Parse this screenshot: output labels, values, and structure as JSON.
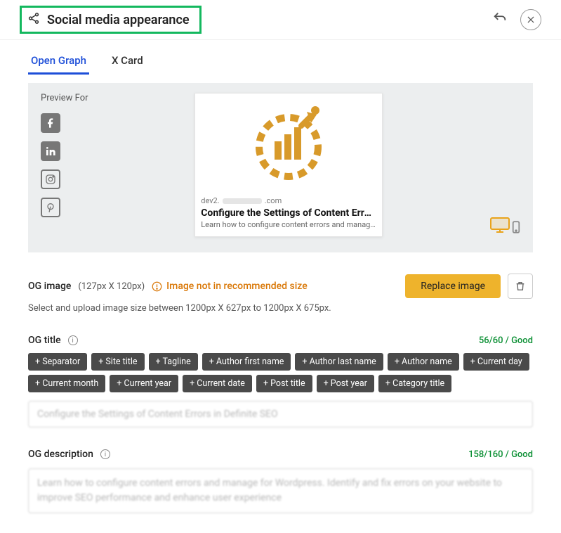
{
  "header": {
    "title": "Social media appearance"
  },
  "tabs": {
    "openGraph": "Open Graph",
    "xCard": "X Card"
  },
  "preview": {
    "label": "Preview For",
    "card": {
      "domain_prefix": "dev2.",
      "domain_suffix": ".com",
      "title": "Configure the Settings of Content Errors i...",
      "desc": "Learn how to configure content errors and manage for ..."
    }
  },
  "ogImage": {
    "title": "OG image",
    "dims": "(127px X 120px)",
    "warning": "Image not in recommended size",
    "sub": "Select and upload image size between 1200px X 627px to 1200px X 675px.",
    "replace": "Replace image"
  },
  "ogTitle": {
    "title": "OG title",
    "counter": "56/60 / Good",
    "tokens": [
      "+ Separator",
      "+ Site title",
      "+ Tagline",
      "+ Author first name",
      "+ Author last name",
      "+ Author name",
      "+ Current day",
      "+ Current month",
      "+ Current year",
      "+ Current date",
      "+ Post title",
      "+ Post year",
      "+ Category title"
    ],
    "value": "Configure the Settings of Content Errors in Definite SEO"
  },
  "ogDesc": {
    "title": "OG description",
    "counter": "158/160 / Good",
    "value": "Learn how to configure content errors and manage for Wordpress. Identify and fix errors on your website to improve SEO performance and enhance user experience"
  }
}
